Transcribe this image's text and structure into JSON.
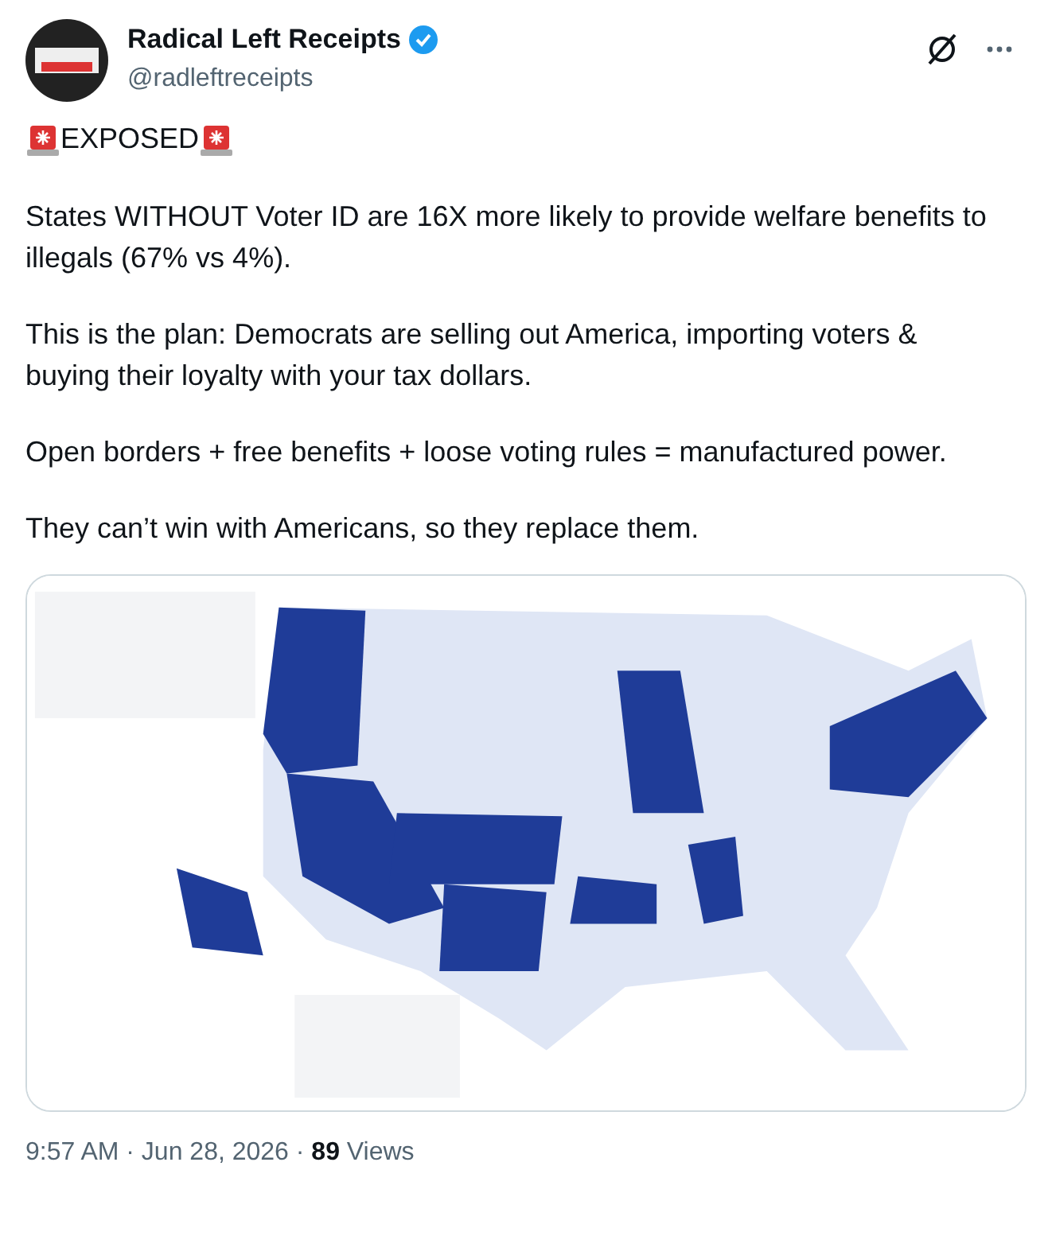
{
  "author": {
    "name": "Radical Left Receipts",
    "handle": "@radleftreceipts",
    "verified": true
  },
  "headline": "EXPOSED",
  "paragraphs": [
    "States WITHOUT Voter ID are 16X more likely to provide welfare benefits to illegals (67% vs 4%).",
    "This is the plan: Democrats are selling out America, importing voters & buying their loyalty with your tax dollars.",
    "Open borders + free benefits + loose voting rules = manufactured power.",
    "They can’t win with Americans, so they replace them."
  ],
  "footer": "9:57 AM · Jun 28, 2026 · **89** Views"
}
